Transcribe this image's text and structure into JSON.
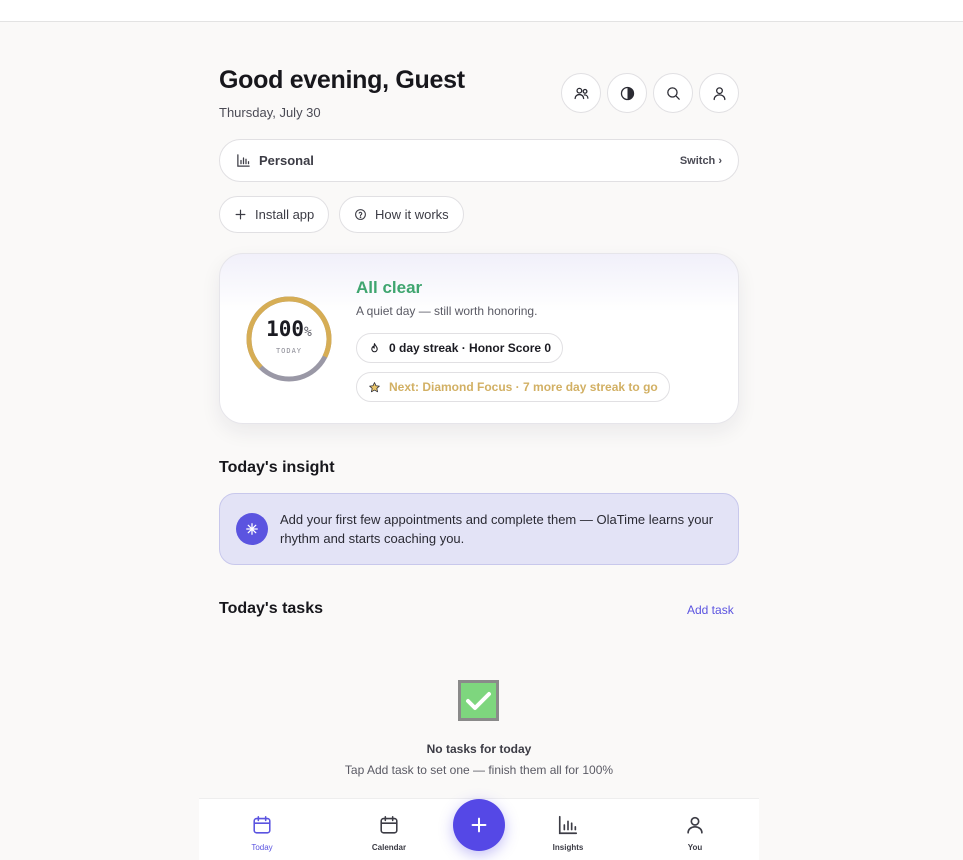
{
  "header": {
    "greeting": "Good evening, Guest",
    "date": "Thursday, July 30",
    "icons": [
      "people-icon",
      "contrast-icon",
      "search-icon",
      "user-icon"
    ]
  },
  "switcher": {
    "label": "Personal",
    "switch_label": "Switch ›"
  },
  "actions": {
    "install_label": "Install app",
    "how_label": "How it works"
  },
  "summary": {
    "percent": "100",
    "percent_sign": "%",
    "ring_caption": "TODAY",
    "progress_fraction": 1.0,
    "title": "All clear",
    "subtitle": "A quiet day — still worth honoring.",
    "streak_text": "0 day streak · Honor Score 0",
    "next_text": "Next: Diamond Focus · 7 more day streak to go",
    "colors": {
      "accent_green": "#3fa56f",
      "ring_gold": "#d6ad55",
      "next_gold": "#d2b064"
    }
  },
  "insight": {
    "title": "Today's insight",
    "text": "Add your first few appointments and complete them — OlaTime learns your rhythm and starts coaching you."
  },
  "tasks": {
    "title": "Today's tasks",
    "add_label": "Add task",
    "empty_title": "No tasks for today",
    "empty_sub": "Tap Add task to set one — finish them all for 100%"
  },
  "nav": {
    "items": [
      {
        "label": "Today",
        "icon": "calendar-icon",
        "active": true
      },
      {
        "label": "Calendar",
        "icon": "calendar-icon",
        "active": false
      },
      {
        "label": "Insights",
        "icon": "bar-chart-icon",
        "active": false
      },
      {
        "label": "You",
        "icon": "user-icon",
        "active": false
      }
    ],
    "fab_icon": "plus-icon"
  },
  "theme": {
    "primary": "#5b54e0",
    "background": "#faf9f8",
    "insight_bg": "#e3e3f6"
  }
}
